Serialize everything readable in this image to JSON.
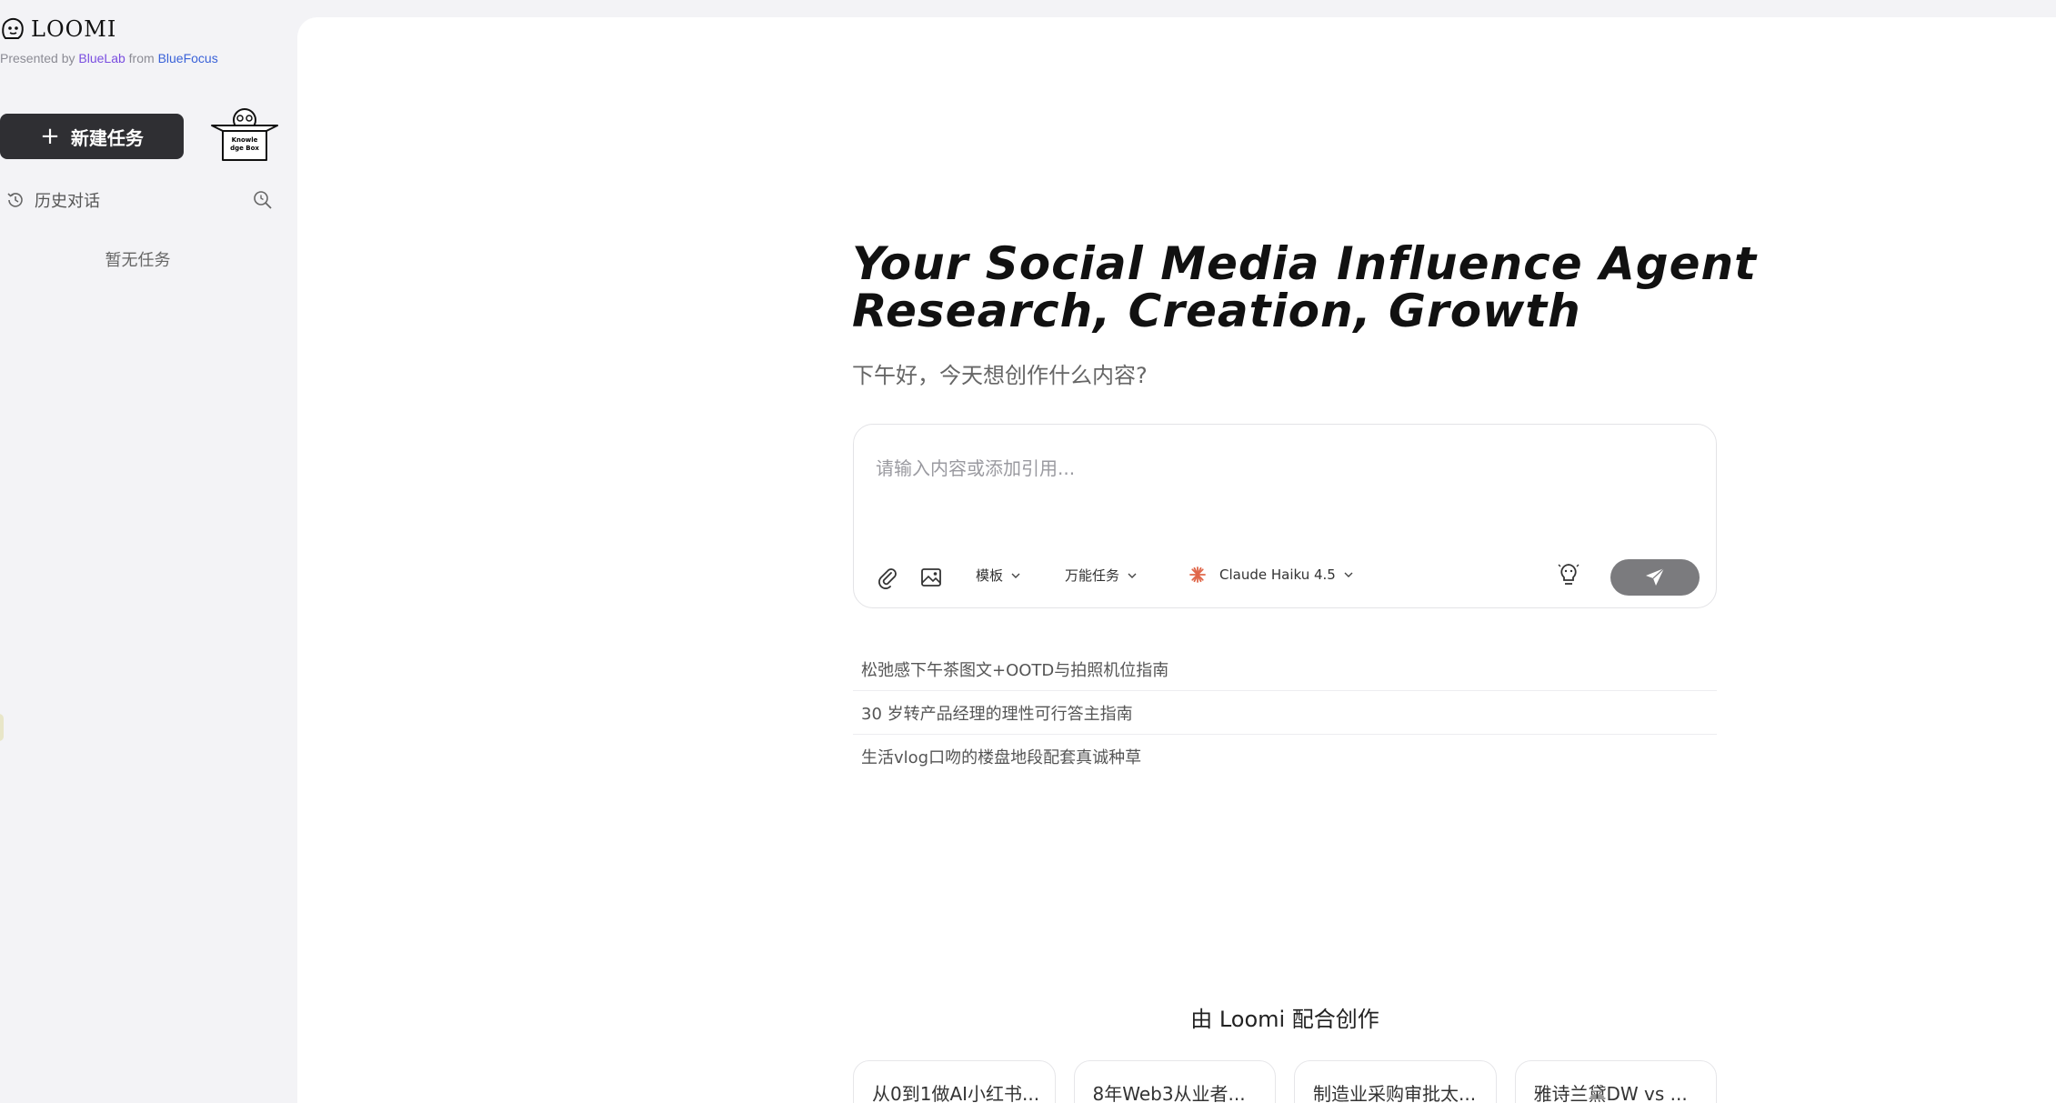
{
  "brand": {
    "name": "LOOMI",
    "presented_prefix": "Presented by ",
    "presented_lab": "BlueLab",
    "presented_mid": " from ",
    "presented_company": "BlueFocus",
    "lab_color": "#7a4ee0",
    "company_color": "#3a62d8"
  },
  "sidebar": {
    "new_task_label": "新建任务",
    "knowledge_box_text": [
      "Knowle",
      "dge Box"
    ],
    "history_label": "历史对话",
    "empty_label": "暂无任务"
  },
  "hero": {
    "line1": "Your Social Media Influence Agent",
    "line2": "Research, Creation, Growth",
    "greeting": "下午好，今天想创作什么内容?"
  },
  "composer": {
    "placeholder": "请输入内容或添加引用...",
    "template_label": "模板",
    "task_label": "万能任务",
    "model_label": "Claude Haiku 4.5",
    "model_icon_color": "#e0674a",
    "send_color": "#7b7b7e"
  },
  "suggestions": [
    "松弛感下午茶图文+OOTD与拍照机位指南",
    "30 岁转产品经理的理性可行答主指南",
    "生活vlog口吻的楼盘地段配套真诚种草"
  ],
  "showcase": {
    "title": "由 Loomi 配合创作",
    "cards": [
      "从0到1做AI小红书...",
      "8年Web3从业者...",
      "制造业采购审批太...",
      "雅诗兰黛DW vs ..."
    ]
  }
}
